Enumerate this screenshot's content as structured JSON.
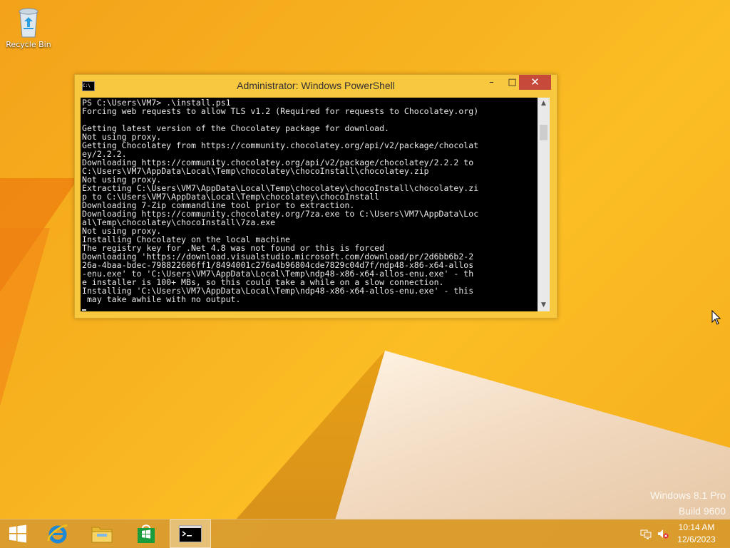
{
  "desktop": {
    "icons": [
      {
        "label": "Recycle Bin",
        "icon": "recycle-bin-icon"
      }
    ],
    "watermark": {
      "line1": "Windows 8.1 Pro",
      "line2": "Build 9600"
    }
  },
  "window": {
    "title": "Administrator: Windows PowerShell",
    "buttons": {
      "minimize": "–",
      "maximize": "□",
      "close": "✕"
    },
    "console_lines": [
      "PS C:\\Users\\VM7> .\\install.ps1",
      "Forcing web requests to allow TLS v1.2 (Required for requests to Chocolatey.org)",
      "",
      "Getting latest version of the Chocolatey package for download.",
      "Not using proxy.",
      "Getting Chocolatey from https://community.chocolatey.org/api/v2/package/chocolat",
      "ey/2.2.2.",
      "Downloading https://community.chocolatey.org/api/v2/package/chocolatey/2.2.2 to",
      "C:\\Users\\VM7\\AppData\\Local\\Temp\\chocolatey\\chocoInstall\\chocolatey.zip",
      "Not using proxy.",
      "Extracting C:\\Users\\VM7\\AppData\\Local\\Temp\\chocolatey\\chocoInstall\\chocolatey.zi",
      "p to C:\\Users\\VM7\\AppData\\Local\\Temp\\chocolatey\\chocoInstall",
      "Downloading 7-Zip commandline tool prior to extraction.",
      "Downloading https://community.chocolatey.org/7za.exe to C:\\Users\\VM7\\AppData\\Loc",
      "al\\Temp\\chocolatey\\chocoInstall\\7za.exe",
      "Not using proxy.",
      "Installing Chocolatey on the local machine",
      "The registry key for .Net 4.8 was not found or this is forced",
      "Downloading 'https://download.visualstudio.microsoft.com/download/pr/2d6bb6b2-2",
      "26a-4baa-bdec-798822606ff1/8494001c276a4b96804cde7829c04d7f/ndp48-x86-x64-allos",
      "-enu.exe' to 'C:\\Users\\VM7\\AppData\\Local\\Temp\\ndp48-x86-x64-allos-enu.exe' - th",
      "e installer is 100+ MBs, so this could take a while on a slow connection.",
      "Installing 'C:\\Users\\VM7\\AppData\\Local\\Temp\\ndp48-x86-x64-allos-enu.exe' - this",
      " may take awhile with no output."
    ]
  },
  "taskbar": {
    "buttons": [
      {
        "name": "start-button",
        "icon": "windows-logo-icon"
      },
      {
        "name": "internet-explorer-button",
        "icon": "internet-explorer-icon"
      },
      {
        "name": "file-explorer-button",
        "icon": "file-explorer-icon"
      },
      {
        "name": "store-button",
        "icon": "store-icon"
      },
      {
        "name": "powershell-taskbar-button",
        "icon": "command-prompt-icon",
        "active": true
      }
    ],
    "tray": {
      "network_icon": "network-icon",
      "volume_icon": "volume-muted-icon"
    },
    "clock": {
      "time": "10:14 AM",
      "date": "12/6/2023"
    }
  },
  "colors": {
    "close_button": "#c7493a",
    "window_frame": "#f8c83e",
    "console_bg": "#000000",
    "console_fg": "#e8e8e8"
  }
}
